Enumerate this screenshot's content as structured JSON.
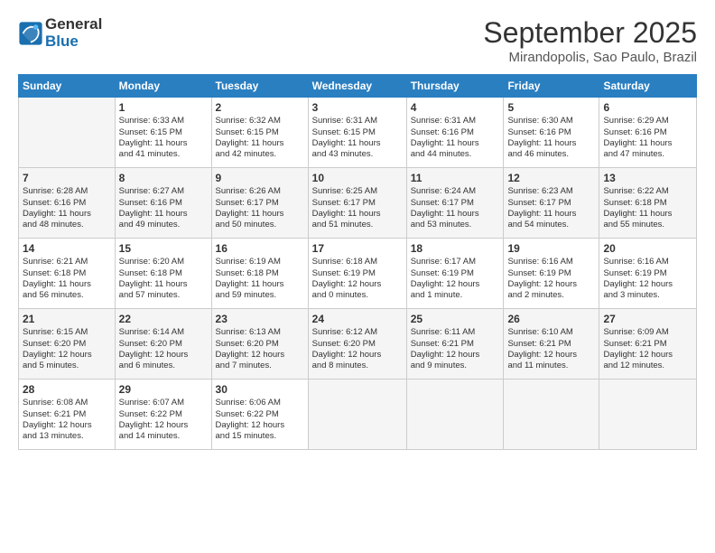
{
  "header": {
    "logo_line1": "General",
    "logo_line2": "Blue",
    "month": "September 2025",
    "location": "Mirandopolis, Sao Paulo, Brazil"
  },
  "days_of_week": [
    "Sunday",
    "Monday",
    "Tuesday",
    "Wednesday",
    "Thursday",
    "Friday",
    "Saturday"
  ],
  "weeks": [
    [
      {
        "num": "",
        "info": ""
      },
      {
        "num": "1",
        "info": "Sunrise: 6:33 AM\nSunset: 6:15 PM\nDaylight: 11 hours\nand 41 minutes."
      },
      {
        "num": "2",
        "info": "Sunrise: 6:32 AM\nSunset: 6:15 PM\nDaylight: 11 hours\nand 42 minutes."
      },
      {
        "num": "3",
        "info": "Sunrise: 6:31 AM\nSunset: 6:15 PM\nDaylight: 11 hours\nand 43 minutes."
      },
      {
        "num": "4",
        "info": "Sunrise: 6:31 AM\nSunset: 6:16 PM\nDaylight: 11 hours\nand 44 minutes."
      },
      {
        "num": "5",
        "info": "Sunrise: 6:30 AM\nSunset: 6:16 PM\nDaylight: 11 hours\nand 46 minutes."
      },
      {
        "num": "6",
        "info": "Sunrise: 6:29 AM\nSunset: 6:16 PM\nDaylight: 11 hours\nand 47 minutes."
      }
    ],
    [
      {
        "num": "7",
        "info": "Sunrise: 6:28 AM\nSunset: 6:16 PM\nDaylight: 11 hours\nand 48 minutes."
      },
      {
        "num": "8",
        "info": "Sunrise: 6:27 AM\nSunset: 6:16 PM\nDaylight: 11 hours\nand 49 minutes."
      },
      {
        "num": "9",
        "info": "Sunrise: 6:26 AM\nSunset: 6:17 PM\nDaylight: 11 hours\nand 50 minutes."
      },
      {
        "num": "10",
        "info": "Sunrise: 6:25 AM\nSunset: 6:17 PM\nDaylight: 11 hours\nand 51 minutes."
      },
      {
        "num": "11",
        "info": "Sunrise: 6:24 AM\nSunset: 6:17 PM\nDaylight: 11 hours\nand 53 minutes."
      },
      {
        "num": "12",
        "info": "Sunrise: 6:23 AM\nSunset: 6:17 PM\nDaylight: 11 hours\nand 54 minutes."
      },
      {
        "num": "13",
        "info": "Sunrise: 6:22 AM\nSunset: 6:18 PM\nDaylight: 11 hours\nand 55 minutes."
      }
    ],
    [
      {
        "num": "14",
        "info": "Sunrise: 6:21 AM\nSunset: 6:18 PM\nDaylight: 11 hours\nand 56 minutes."
      },
      {
        "num": "15",
        "info": "Sunrise: 6:20 AM\nSunset: 6:18 PM\nDaylight: 11 hours\nand 57 minutes."
      },
      {
        "num": "16",
        "info": "Sunrise: 6:19 AM\nSunset: 6:18 PM\nDaylight: 11 hours\nand 59 minutes."
      },
      {
        "num": "17",
        "info": "Sunrise: 6:18 AM\nSunset: 6:19 PM\nDaylight: 12 hours\nand 0 minutes."
      },
      {
        "num": "18",
        "info": "Sunrise: 6:17 AM\nSunset: 6:19 PM\nDaylight: 12 hours\nand 1 minute."
      },
      {
        "num": "19",
        "info": "Sunrise: 6:16 AM\nSunset: 6:19 PM\nDaylight: 12 hours\nand 2 minutes."
      },
      {
        "num": "20",
        "info": "Sunrise: 6:16 AM\nSunset: 6:19 PM\nDaylight: 12 hours\nand 3 minutes."
      }
    ],
    [
      {
        "num": "21",
        "info": "Sunrise: 6:15 AM\nSunset: 6:20 PM\nDaylight: 12 hours\nand 5 minutes."
      },
      {
        "num": "22",
        "info": "Sunrise: 6:14 AM\nSunset: 6:20 PM\nDaylight: 12 hours\nand 6 minutes."
      },
      {
        "num": "23",
        "info": "Sunrise: 6:13 AM\nSunset: 6:20 PM\nDaylight: 12 hours\nand 7 minutes."
      },
      {
        "num": "24",
        "info": "Sunrise: 6:12 AM\nSunset: 6:20 PM\nDaylight: 12 hours\nand 8 minutes."
      },
      {
        "num": "25",
        "info": "Sunrise: 6:11 AM\nSunset: 6:21 PM\nDaylight: 12 hours\nand 9 minutes."
      },
      {
        "num": "26",
        "info": "Sunrise: 6:10 AM\nSunset: 6:21 PM\nDaylight: 12 hours\nand 11 minutes."
      },
      {
        "num": "27",
        "info": "Sunrise: 6:09 AM\nSunset: 6:21 PM\nDaylight: 12 hours\nand 12 minutes."
      }
    ],
    [
      {
        "num": "28",
        "info": "Sunrise: 6:08 AM\nSunset: 6:21 PM\nDaylight: 12 hours\nand 13 minutes."
      },
      {
        "num": "29",
        "info": "Sunrise: 6:07 AM\nSunset: 6:22 PM\nDaylight: 12 hours\nand 14 minutes."
      },
      {
        "num": "30",
        "info": "Sunrise: 6:06 AM\nSunset: 6:22 PM\nDaylight: 12 hours\nand 15 minutes."
      },
      {
        "num": "",
        "info": ""
      },
      {
        "num": "",
        "info": ""
      },
      {
        "num": "",
        "info": ""
      },
      {
        "num": "",
        "info": ""
      }
    ]
  ]
}
